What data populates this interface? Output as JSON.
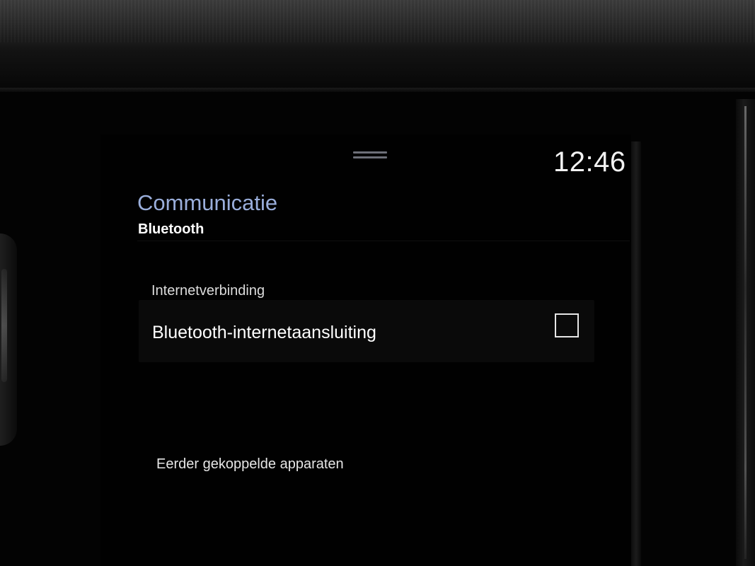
{
  "status_bar": {
    "clock": "12:46"
  },
  "app": {
    "title": "Communicatie",
    "subtitle": "Bluetooth"
  },
  "sections": [
    {
      "label": "Internetverbinding",
      "settings": [
        {
          "label": "Bluetooth-internetaansluiting",
          "checked": false
        }
      ]
    }
  ],
  "lists": {
    "paired_devices_label": "Eerder gekoppelde apparaten"
  },
  "icons": {
    "handle": "drag-handle-icon",
    "checkbox": "checkbox-unchecked-icon"
  },
  "colors": {
    "title_accent": "#9aaedb",
    "text_primary": "#ffffff",
    "screen_background": "#010101"
  }
}
